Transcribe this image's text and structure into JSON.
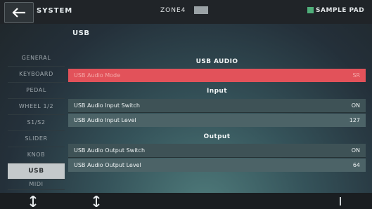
{
  "header": {
    "title": "SYSTEM",
    "zone": "ZONE4",
    "sample_pad": "SAMPLE PAD"
  },
  "page_title": "USB",
  "sidebar": {
    "items": [
      {
        "label": "GENERAL"
      },
      {
        "label": "KEYBOARD"
      },
      {
        "label": "PEDAL"
      },
      {
        "label": "WHEEL 1/2"
      },
      {
        "label": "S1/S2"
      },
      {
        "label": "SLIDER"
      },
      {
        "label": "KNOB"
      },
      {
        "label": "USB"
      },
      {
        "label": "MIDI"
      }
    ],
    "active": "USB"
  },
  "main": {
    "usb_audio_title": "USB AUDIO",
    "usb_audio_mode": {
      "label": "USB Audio Mode",
      "value": "SR"
    },
    "input_title": "Input",
    "input_switch": {
      "label": "USB Audio Input Switch",
      "value": "ON"
    },
    "input_level": {
      "label": "USB Audio Input Level",
      "value": "127"
    },
    "output_title": "Output",
    "output_switch": {
      "label": "USB Audio Output Switch",
      "value": "ON"
    },
    "output_level": {
      "label": "USB Audio Output Level",
      "value": "64"
    }
  },
  "colors": {
    "highlight": "#e2525a",
    "active_tab": "#c4c9cb",
    "sample_pad_indicator": "#4fae7a"
  },
  "icons": {
    "back": "arrow-left-icon",
    "knob1": "up-down-arrow-icon",
    "knob2": "up-down-arrow-icon"
  }
}
